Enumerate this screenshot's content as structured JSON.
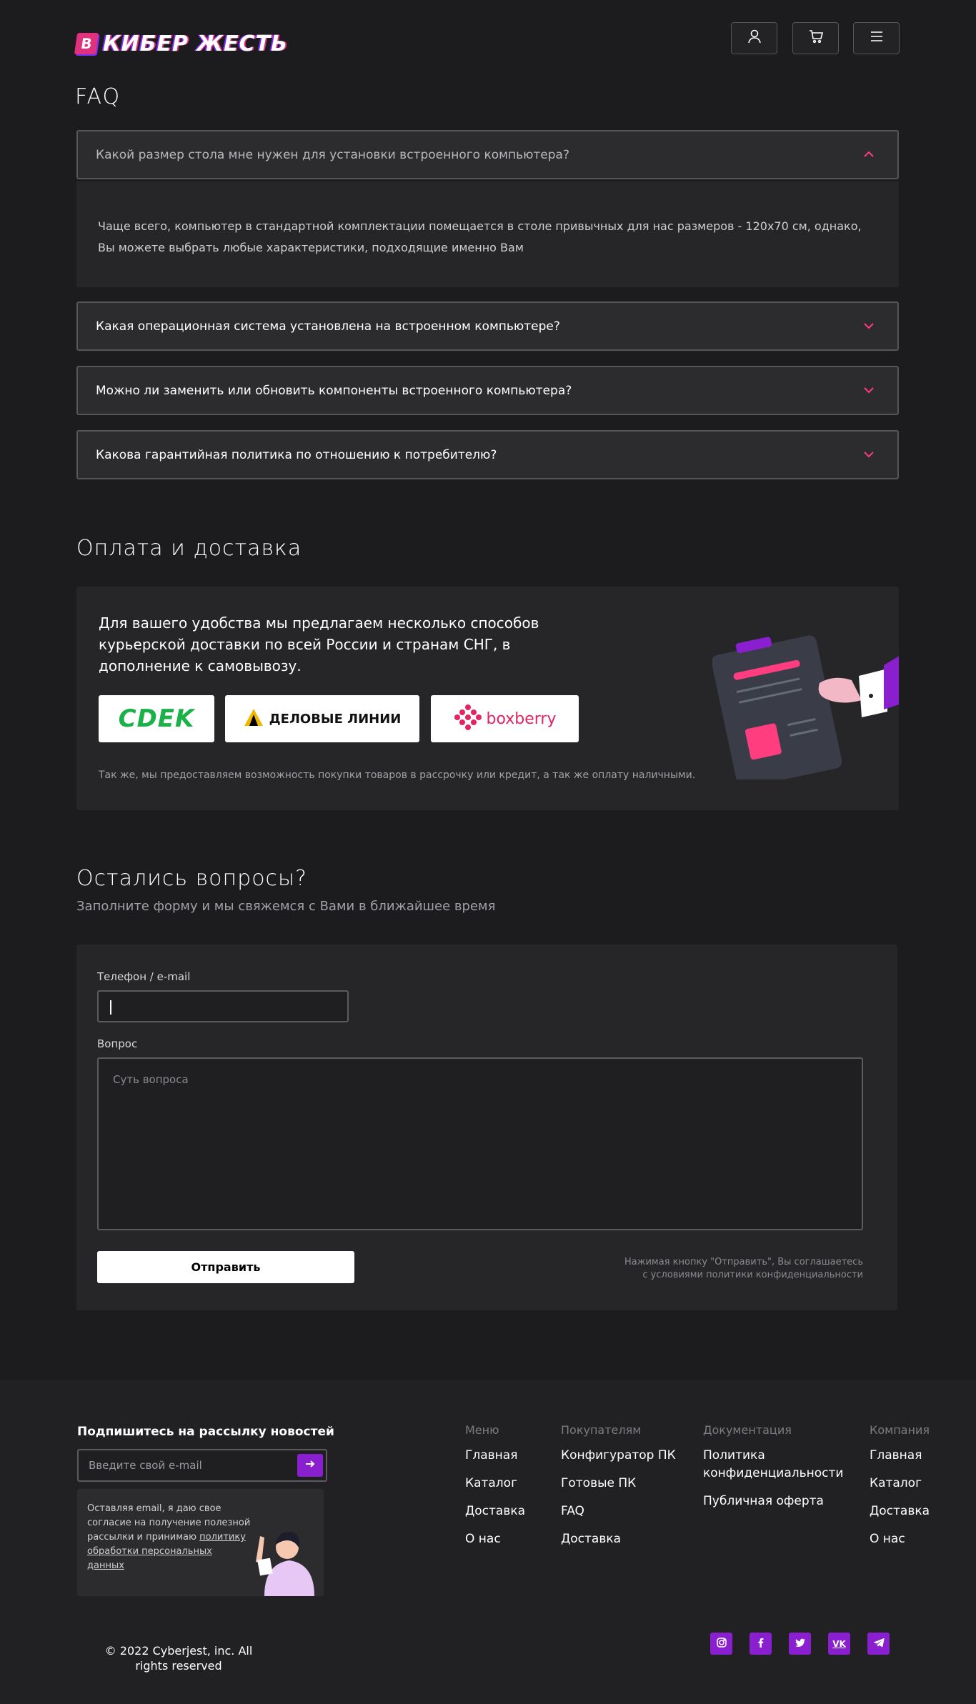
{
  "header": {
    "logo_text": "КИБЕР ЖЕСТЬ",
    "logo_mark": "В",
    "icons": [
      "user-icon",
      "cart-icon",
      "menu-icon"
    ]
  },
  "faq": {
    "title": "FAQ",
    "items": [
      {
        "question": "Какой размер стола мне нужен для установки встроенного компьютера?",
        "open": true
      },
      {
        "question": "Какая операционная система установлена на встроенном компьютере?",
        "open": false
      },
      {
        "question": "Можно ли заменить или обновить компоненты встроенного компьютера?",
        "open": false
      },
      {
        "question": "Какова гарантийная политика по отношению к потребителю?",
        "open": false
      }
    ],
    "answer": "Чаще всего, компьютер в стандартной комплектации помещается в столе привычных для нас размеров - 120х70 см, однако, Вы можете выбрать любые характеристики, подходящие именно Вам"
  },
  "delivery": {
    "title": "Оплата и доставка",
    "text": "Для вашего удобства мы предлагаем несколько способов курьерской доставки по всей России и странам СНГ, в дополнение к самовывозу.",
    "carriers": [
      "CDEK",
      "ДЕЛОВЫЕ ЛИНИИ",
      "boxberry"
    ],
    "note": "Так же, мы предоставляем возможность покупки товаров в рассрочку или кредит, а так же оплату наличными.",
    "colors": {
      "cdek": "#1ab248",
      "delovye": "#f2b600",
      "boxberry": "#e4235f"
    }
  },
  "questions": {
    "title": "Остались вопросы?",
    "subtitle": "Заполните форму и мы свяжемся с Вами в ближайшее время",
    "contact_label": "Телефон / e-mail",
    "contact_value": "",
    "question_label": "Вопрос",
    "question_placeholder": "Суть вопроса",
    "submit_label": "Отправить",
    "consent": "Нажимая кнопку \"Отправить\", Вы соглашаетесь с условиями политики конфиденциальности"
  },
  "footer": {
    "subscribe_title": "Подпишитесь на рассылку новостей",
    "email_placeholder": "Введите свой e-mail",
    "consent_prefix": "Оставляя email, я даю свое согласие на получение полезной рассылки и принимаю ",
    "consent_link": "политику обработки персональных данных",
    "columns": [
      {
        "title": "Меню",
        "links": [
          "Главная",
          "Каталог",
          "Доставка",
          "О нас"
        ]
      },
      {
        "title": "Покупателям",
        "links": [
          "Конфигуратор ПК",
          "Готовые ПК",
          "FAQ",
          "Доставка"
        ]
      },
      {
        "title": "Документация",
        "links": [
          "Политика конфиденциальности",
          "Публичная оферта"
        ]
      },
      {
        "title": "Компания",
        "links": [
          "Главная",
          "Каталог",
          "Доставка",
          "О нас"
        ]
      }
    ],
    "copyright": "© 2022 Cyberjest, inc. All rights reserved",
    "social": [
      "instagram-icon",
      "facebook-icon",
      "twitter-icon",
      "vk-icon",
      "telegram-icon"
    ],
    "accent": "#8a1fd0"
  }
}
